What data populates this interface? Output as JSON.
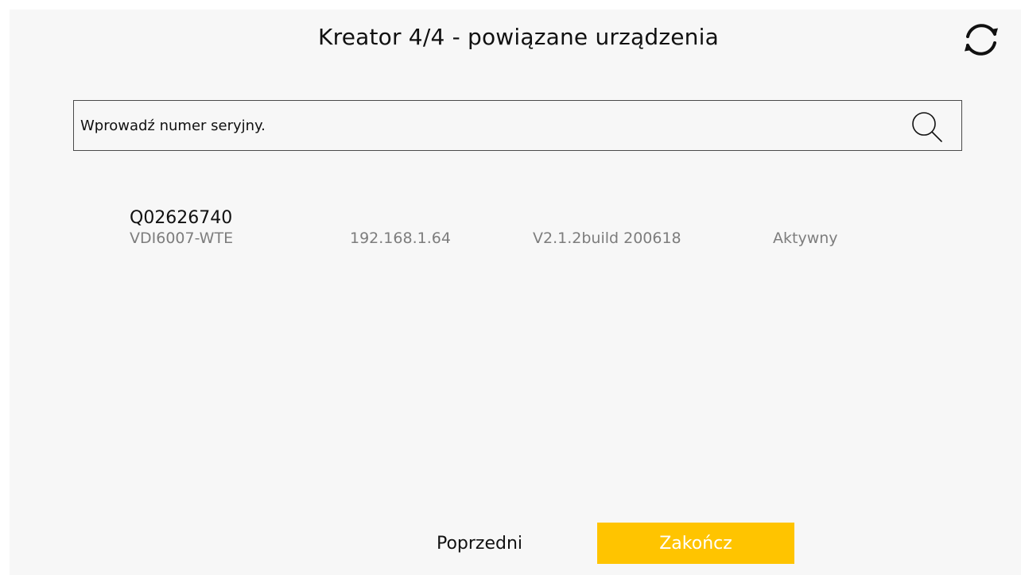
{
  "header": {
    "title": "Kreator 4/4 - powiązane urządzenia",
    "refresh_icon": "refresh-icon"
  },
  "search": {
    "placeholder": "Wprowadź numer seryjny.",
    "value": "",
    "icon": "search-icon"
  },
  "devices": [
    {
      "serial": "Q02626740",
      "model": "VDI6007-WTE",
      "ip": "192.168.1.64",
      "firmware": "V2.1.2build 200618",
      "status": "Aktywny"
    }
  ],
  "footer": {
    "previous_label": "Poprzedni",
    "finish_label": "Zakończ"
  },
  "colors": {
    "accent": "#ffc400",
    "panel_background": "#f7f7f7",
    "secondary_text": "#7d7d7d"
  }
}
